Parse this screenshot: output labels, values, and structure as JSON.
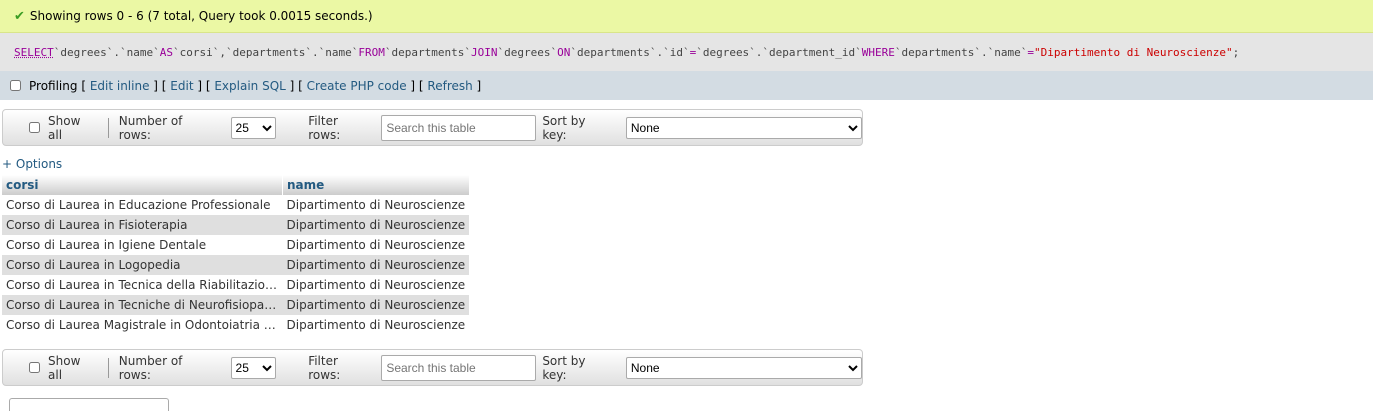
{
  "success_message": "Showing rows 0 - 6 (7 total, Query took 0.0015 seconds.)",
  "sql": {
    "select": "SELECT",
    "part1": " `degrees`.`name` ",
    "as": "AS",
    "part2": " `corsi`,`departments`.`name` ",
    "from": "FROM",
    "part3": " `departments` ",
    "join": "JOIN",
    "part4": " `degrees` ",
    "on": "ON",
    "part5": " `departments`.`id` ",
    "eq1": "=",
    "part6": " `degrees`.`department_id` ",
    "where": "WHERE",
    "part7": " `departments`.`name`",
    "eq2": "=",
    "str": " \"Dipartimento di Neuroscienze\"",
    "end": ";"
  },
  "profiling": {
    "label": "Profiling",
    "links": [
      "Edit inline",
      "Edit",
      "Explain SQL",
      "Create PHP code",
      "Refresh"
    ]
  },
  "navbar": {
    "show_all": "Show all",
    "number_of_rows_label": "Number of rows:",
    "number_of_rows_value": "25",
    "filter_label": "Filter rows:",
    "filter_placeholder": "Search this table",
    "sort_label": "Sort by key:",
    "sort_value": "None"
  },
  "options_link": "+ Options",
  "table": {
    "headers": [
      "corsi",
      "name"
    ],
    "rows": [
      [
        "Corso di Laurea in Educazione Professionale",
        "Dipartimento di Neuroscienze"
      ],
      [
        "Corso di Laurea in Fisioterapia",
        "Dipartimento di Neuroscienze"
      ],
      [
        "Corso di Laurea in Igiene Dentale",
        "Dipartimento di Neuroscienze"
      ],
      [
        "Corso di Laurea in Logopedia",
        "Dipartimento di Neuroscienze"
      ],
      [
        "Corso di Laurea in Tecnica della Riabilitazione Ps...",
        "Dipartimento di Neuroscienze"
      ],
      [
        "Corso di Laurea in Tecniche di Neurofisiopatologia",
        "Dipartimento di Neuroscienze"
      ],
      [
        "Corso di Laurea Magistrale in Odontoiatria e Prote...",
        "Dipartimento di Neuroscienze"
      ]
    ]
  }
}
